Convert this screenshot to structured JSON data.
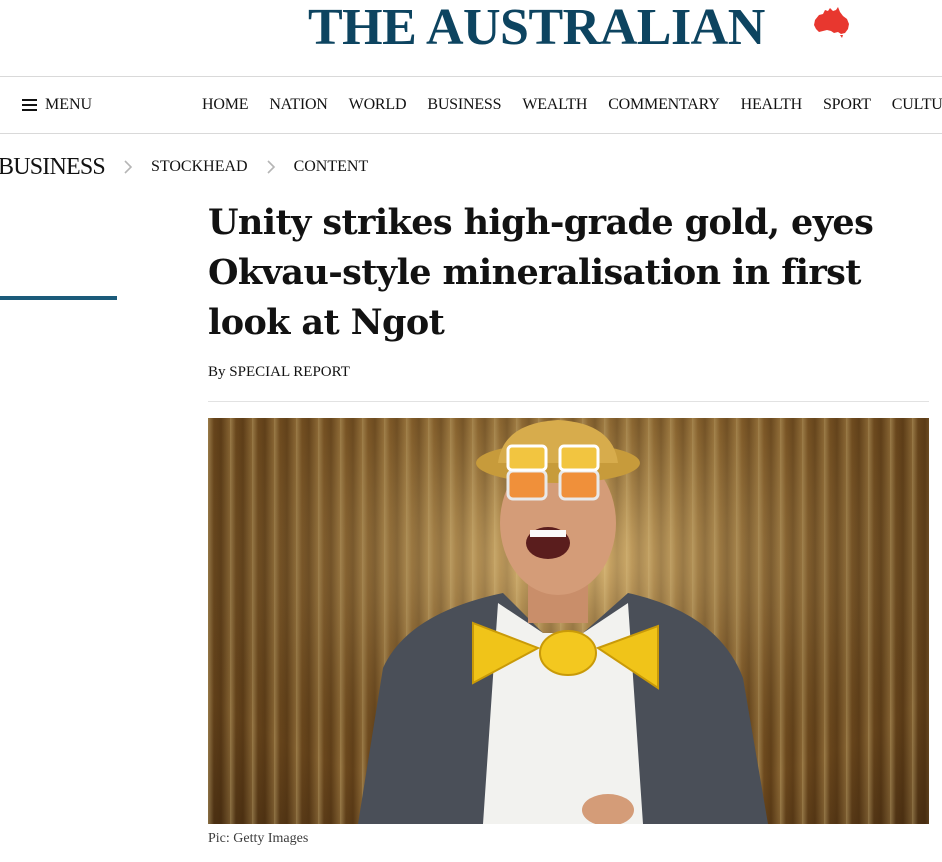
{
  "masthead": {
    "logo_text": "THE AUSTRALIAN",
    "logo_icon": "australia-map-icon",
    "logo_color": "#0d4460",
    "map_color": "#e8372f"
  },
  "nav": {
    "menu_label": "MENU",
    "menu_icon": "hamburger-icon",
    "links": [
      "HOME",
      "NATION",
      "WORLD",
      "BUSINESS",
      "WEALTH",
      "COMMENTARY",
      "HEALTH",
      "SPORT",
      "CULTURE"
    ]
  },
  "breadcrumb": {
    "section": "BUSINESS",
    "items": [
      "STOCKHEAD",
      "CONTENT"
    ],
    "separator_icon": "chevron-right-icon"
  },
  "article": {
    "headline": "Unity strikes high-grade gold, eyes Okvau-style mineralisation in first look at Ngot",
    "byline_prefix": "By",
    "author": "SPECIAL REPORT",
    "image_caption": "Pic: Getty Images"
  },
  "colors": {
    "accent": "#1b5b7a",
    "text": "#121212",
    "divider": "#d9d9d9"
  }
}
